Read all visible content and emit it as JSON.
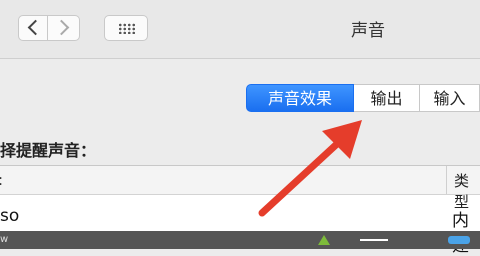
{
  "window": {
    "title": "声音"
  },
  "toolbar": {
    "back_icon": "chevron-left-icon",
    "forward_icon": "chevron-right-icon",
    "grid_icon": "grid-dots-icon"
  },
  "tabs": [
    {
      "label": "声音效果",
      "selected": true
    },
    {
      "label": "输出",
      "selected": false
    },
    {
      "label": "输入",
      "selected": false
    }
  ],
  "section_label": "择提醒声音：",
  "table": {
    "header_left": ":",
    "header_type": "类型",
    "rows": [
      {
        "name": "so",
        "type": "内建"
      }
    ]
  },
  "footer": {
    "left_text": "w"
  },
  "colors": {
    "accent": "#1a6ff0",
    "arrow": "#e53d2b"
  }
}
